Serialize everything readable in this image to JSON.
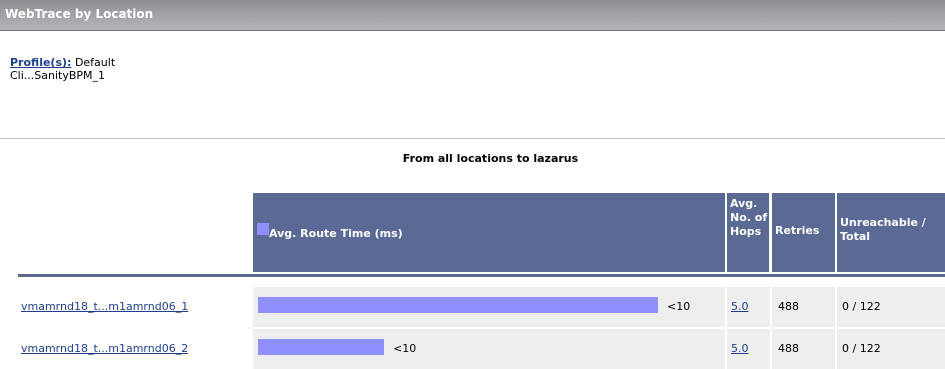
{
  "window": {
    "title": "WebTrace by Location"
  },
  "profile": {
    "label": "Profile(s):",
    "value": "Default",
    "name": "Cli...SanityBPM_1"
  },
  "report": {
    "heading": "From all locations to lazarus"
  },
  "table": {
    "headers": {
      "route_time": "Avg. Route Time (ms)",
      "hops": "Avg. No. of Hops",
      "retries": "Retries",
      "unreachable": "Unreachable / Total"
    },
    "legend_color": "#8f8fff",
    "rows": [
      {
        "location": "vmamrnd18_t...m1amrnd06_1",
        "route_time_label": "<10",
        "route_bar_fraction": 0.86,
        "hops": "5.0",
        "retries": "488",
        "unreachable_total": "0 / 122"
      },
      {
        "location": "vmamrnd18_t...m1amrnd06_2",
        "route_time_label": "<10",
        "route_bar_fraction": 0.27,
        "hops": "5.0",
        "retries": "488",
        "unreachable_total": "0 / 122"
      }
    ]
  }
}
